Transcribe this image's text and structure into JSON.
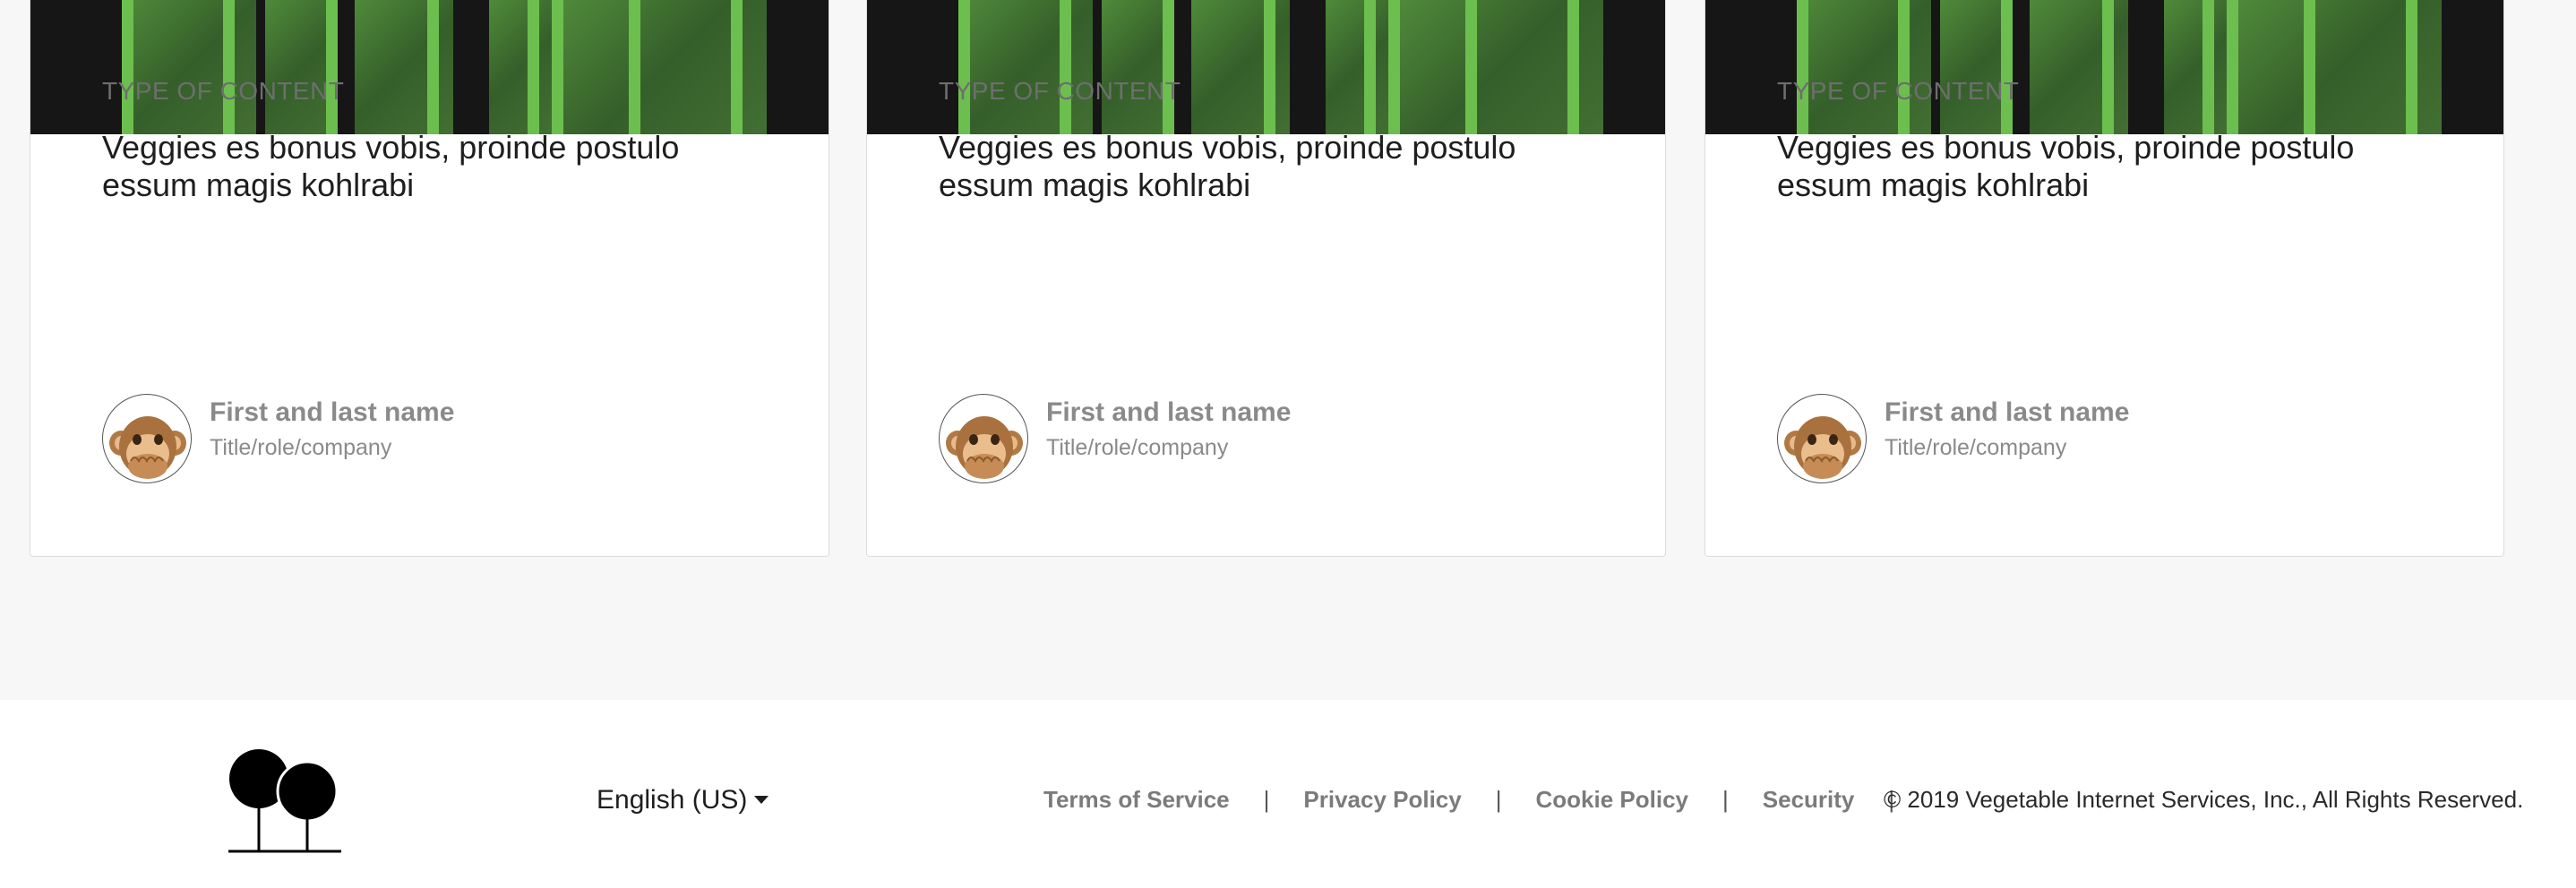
{
  "cards": [
    {
      "type_label": "TYPE OF CONTENT",
      "headline": "Veggies es bonus vobis, proinde postulo essum magis kohlrabi",
      "author_name": "First and last name",
      "author_title": "Title/role/company",
      "avatar_icon": "monkey-see-no-evil-icon"
    },
    {
      "type_label": "TYPE OF CONTENT",
      "headline": "Veggies es bonus vobis, proinde postulo essum magis kohlrabi",
      "author_name": "First and last name",
      "author_title": "Title/role/company",
      "avatar_icon": "monkey-see-no-evil-icon"
    },
    {
      "type_label": "TYPE OF CONTENT",
      "headline": "Veggies es bonus vobis, proinde postulo essum magis kohlrabi",
      "author_name": "First and last name",
      "author_title": "Title/role/company",
      "avatar_icon": "monkey-see-no-evil-icon"
    }
  ],
  "footer": {
    "logo_icon": "two-trees-logo-icon",
    "language": "English (US)",
    "links": [
      "Terms of Service",
      "Privacy Policy",
      "Cookie Policy",
      "Security"
    ],
    "separator": "|",
    "copyright": "© 2019 Vegetable Internet Services, Inc., All Rights Reserved."
  },
  "colors": {
    "page_background": "#f7f7f7",
    "banner_dark": "#161616",
    "banner_green": "#6cbf4e",
    "link_gray": "#7b7b7b"
  }
}
